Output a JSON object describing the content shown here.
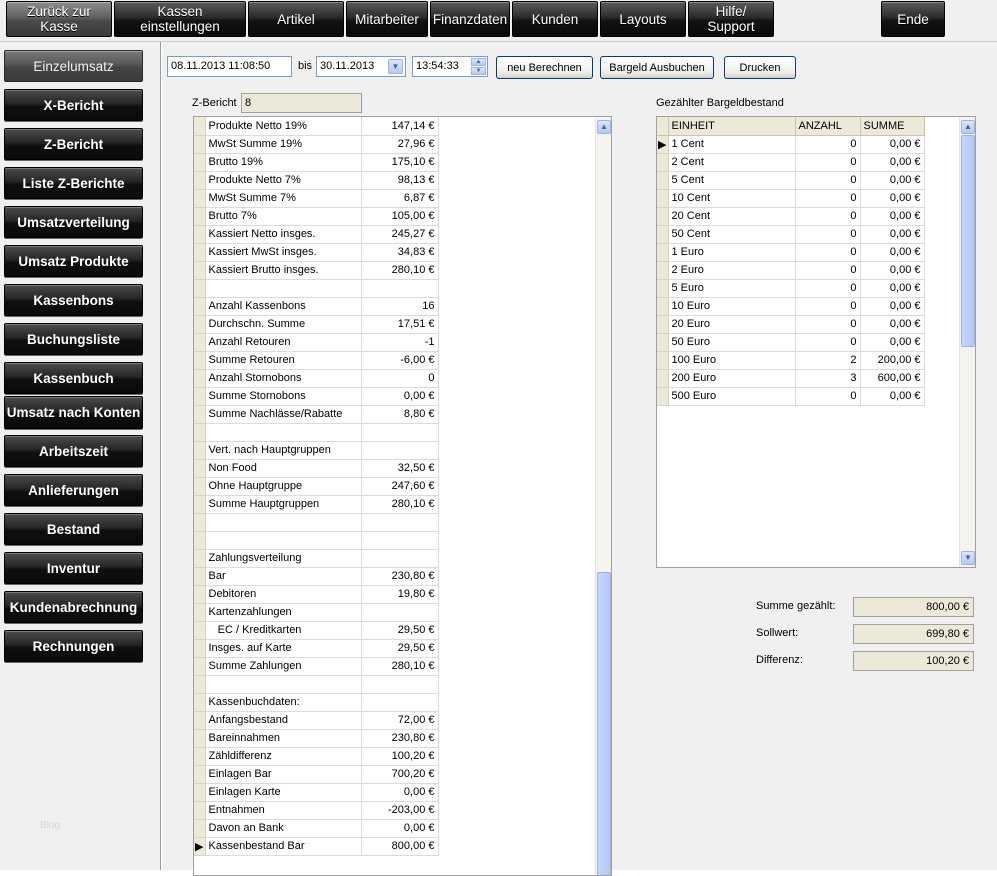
{
  "topnav": [
    {
      "label": "Zurück zur\nKasse",
      "active": true
    },
    {
      "label": "Kassen\neinstellungen"
    },
    {
      "label": "Artikel"
    },
    {
      "label": "Mitarbeiter"
    },
    {
      "label": "Finanzdaten"
    },
    {
      "label": "Kunden"
    },
    {
      "label": "Layouts"
    },
    {
      "label": "Hilfe/\nSupport"
    },
    {
      "label": "Ende"
    }
  ],
  "sidebar": {
    "items": [
      {
        "label": "Einzelumsatz",
        "active": true
      },
      {
        "label": "X-Bericht"
      },
      {
        "label": "Z-Bericht"
      },
      {
        "label": "Liste Z-Berichte"
      },
      {
        "label": "Umsatzverteilung"
      },
      {
        "label": "Umsatz Produkte"
      },
      {
        "label": "Kassenbons"
      },
      {
        "label": "Buchungsliste"
      },
      {
        "label": "Kassenbuch"
      },
      {
        "label": "Umsatz nach Konten"
      },
      {
        "label": "Arbeitszeit"
      },
      {
        "label": "Anlieferungen"
      },
      {
        "label": "Bestand"
      },
      {
        "label": "Inventur"
      },
      {
        "label": "Kundenabrechnung"
      },
      {
        "label": "Rechnungen"
      }
    ],
    "watermark": "Blog"
  },
  "filter": {
    "from_datetime": "08.11.2013 11:08:50",
    "bis_label": "bis",
    "to_date": "30.11.2013",
    "to_time": "13:54:33",
    "recalc_button": "neu Berechnen",
    "cash_out_button": "Bargeld Ausbuchen",
    "print_button": "Drucken"
  },
  "zbericht": {
    "label": "Z-Bericht",
    "value": "8"
  },
  "report_rows": [
    {
      "label": "Produkte Netto 19%",
      "value": "147,14 €"
    },
    {
      "label": "MwSt Summe 19%",
      "value": "27,96 €"
    },
    {
      "label": "Brutto 19%",
      "value": "175,10 €"
    },
    {
      "label": "Produkte Netto 7%",
      "value": "98,13 €"
    },
    {
      "label": "MwSt Summe 7%",
      "value": "6,87 €"
    },
    {
      "label": "Brutto 7%",
      "value": "105,00 €"
    },
    {
      "label": "Kassiert Netto insges.",
      "value": "245,27 €"
    },
    {
      "label": "Kassiert MwSt insges.",
      "value": "34,83 €"
    },
    {
      "label": "Kassiert Brutto insges.",
      "value": "280,10 €"
    },
    {
      "label": "",
      "value": ""
    },
    {
      "label": "Anzahl Kassenbons",
      "value": "16"
    },
    {
      "label": "Durchschn. Summe",
      "value": "17,51 €"
    },
    {
      "label": "Anzahl Retouren",
      "value": "-1"
    },
    {
      "label": "Summe Retouren",
      "value": "-6,00 €"
    },
    {
      "label": "Anzahl Stornobons",
      "value": "0"
    },
    {
      "label": "Summe Stornobons",
      "value": "0,00 €"
    },
    {
      "label": "Summe Nachlässe/Rabatte",
      "value": "8,80 €"
    },
    {
      "label": "",
      "value": ""
    },
    {
      "label": "Vert. nach Hauptgruppen",
      "value": ""
    },
    {
      "label": "Non Food",
      "value": "32,50 €"
    },
    {
      "label": "Ohne Hauptgruppe",
      "value": "247,60 €"
    },
    {
      "label": "Summe Hauptgruppen",
      "value": "280,10 €"
    },
    {
      "label": "",
      "value": ""
    },
    {
      "label": "",
      "value": ""
    },
    {
      "label": "Zahlungsverteilung",
      "value": ""
    },
    {
      "label": "Bar",
      "value": "230,80 €"
    },
    {
      "label": "Debitoren",
      "value": "19,80 €"
    },
    {
      "label": "Kartenzahlungen",
      "value": ""
    },
    {
      "label": "   EC / Kreditkarten",
      "value": "29,50 €"
    },
    {
      "label": "Insges. auf Karte",
      "value": "29,50 €"
    },
    {
      "label": "Summe Zahlungen",
      "value": "280,10 €"
    },
    {
      "label": "",
      "value": ""
    },
    {
      "label": "Kassenbuchdaten:",
      "value": ""
    },
    {
      "label": "Anfangsbestand",
      "value": "72,00 €"
    },
    {
      "label": "Bareinnahmen",
      "value": "230,80 €"
    },
    {
      "label": "Zähldifferenz",
      "value": "100,20 €"
    },
    {
      "label": "Einlagen Bar",
      "value": "700,20 €"
    },
    {
      "label": "Einlagen Karte",
      "value": "0,00 €"
    },
    {
      "label": "Entnahmen",
      "value": "-203,00 €"
    },
    {
      "label": "Davon an Bank",
      "value": "0,00 €"
    },
    {
      "label": "Kassenbestand Bar",
      "value": "800,00 €",
      "current": true
    }
  ],
  "cash_count": {
    "title": "Gezählter Bargeldbestand",
    "headers": [
      "EINHEIT",
      "ANZAHL",
      "SUMME"
    ],
    "rows": [
      {
        "unit": "1 Cent",
        "count": "0",
        "sum": "0,00 €",
        "current": true
      },
      {
        "unit": "2 Cent",
        "count": "0",
        "sum": "0,00 €"
      },
      {
        "unit": "5 Cent",
        "count": "0",
        "sum": "0,00 €"
      },
      {
        "unit": "10 Cent",
        "count": "0",
        "sum": "0,00 €"
      },
      {
        "unit": "20 Cent",
        "count": "0",
        "sum": "0,00 €"
      },
      {
        "unit": "50 Cent",
        "count": "0",
        "sum": "0,00 €"
      },
      {
        "unit": "1 Euro",
        "count": "0",
        "sum": "0,00 €"
      },
      {
        "unit": "2 Euro",
        "count": "0",
        "sum": "0,00 €"
      },
      {
        "unit": "5 Euro",
        "count": "0",
        "sum": "0,00 €"
      },
      {
        "unit": "10 Euro",
        "count": "0",
        "sum": "0,00 €"
      },
      {
        "unit": "20 Euro",
        "count": "0",
        "sum": "0,00 €"
      },
      {
        "unit": "50 Euro",
        "count": "0",
        "sum": "0,00 €"
      },
      {
        "unit": "100 Euro",
        "count": "2",
        "sum": "200,00 €"
      },
      {
        "unit": "200 Euro",
        "count": "3",
        "sum": "600,00 €"
      },
      {
        "unit": "500 Euro",
        "count": "0",
        "sum": "0,00 €"
      }
    ]
  },
  "totals": {
    "counted_label": "Summe gezählt:",
    "counted_value": "800,00 €",
    "target_label": "Sollwert:",
    "target_value": "699,80 €",
    "diff_label": "Differenz:",
    "diff_value": "100,20 €"
  },
  "icons": {
    "scroll_up": "▲",
    "scroll_down": "▼",
    "row_pointer": "▶",
    "dropdown": "▼"
  }
}
